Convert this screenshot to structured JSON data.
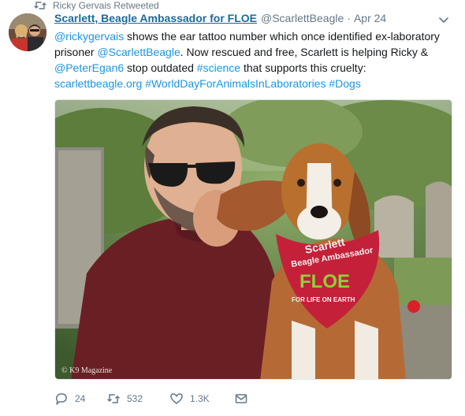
{
  "retweet_context": {
    "icon": "retweet-icon",
    "label": "Ricky Gervais Retweeted"
  },
  "tweet": {
    "fullname": "Scarlett, Beagle Ambassador for FLOE",
    "username": "@ScarlettBeagle",
    "separator": "·",
    "timestamp": "Apr 24",
    "caret_icon": "chevron-down-icon",
    "text_lines": [
      [
        {
          "t": "@rickygervais",
          "link": true
        },
        {
          "t": " shows the ear tattoo number which once identified ex-laboratory",
          "link": false
        }
      ],
      [
        {
          "t": "prisoner ",
          "link": false
        },
        {
          "t": "@ScarlettBeagle",
          "link": true
        },
        {
          "t": ". Now rescued and free, Scarlett is helping Ricky &",
          "link": false
        }
      ],
      [
        {
          "t": "@PeterEgan6",
          "link": true
        },
        {
          "t": " stop outdated ",
          "link": false
        },
        {
          "t": "#science",
          "link": true
        },
        {
          "t": " that supports this cruelty:",
          "link": false
        }
      ],
      [
        {
          "t": "scarlettbeagle.org",
          "link": true
        },
        {
          "t": " ",
          "link": false
        },
        {
          "t": "#WorldDayForAnimalsInLaboratories",
          "link": true
        },
        {
          "t": " ",
          "link": false
        },
        {
          "t": "#Dogs",
          "link": true
        }
      ]
    ],
    "media": {
      "watermark": "© K9 Magazine",
      "bandana_lines": [
        "Scarlett",
        "Beagle Ambassador",
        "FLOE",
        "FOR LIFE ON EARTH"
      ]
    },
    "actions": [
      {
        "name": "reply-button",
        "icon": "reply-icon",
        "count": "24"
      },
      {
        "name": "retweet-button",
        "icon": "retweet-icon",
        "count": "532"
      },
      {
        "name": "like-button",
        "icon": "heart-icon",
        "count": "1.3K"
      },
      {
        "name": "direct-message-button",
        "icon": "envelope-icon",
        "count": ""
      }
    ]
  },
  "colors": {
    "link": "#1b95e0",
    "name": "#1a6b9a",
    "muted": "#657786",
    "bandana": "#c4203a"
  }
}
